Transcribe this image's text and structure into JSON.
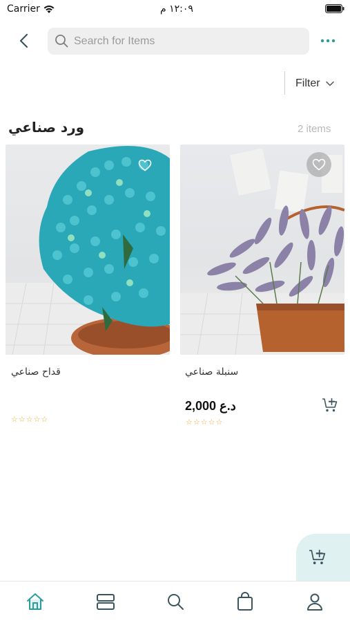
{
  "status_bar": {
    "carrier": "Carrier",
    "time": "١٢:٠٩ م"
  },
  "header": {
    "search_placeholder": "Search for Items",
    "icons": [
      "back-icon",
      "search-icon",
      "more-icon"
    ]
  },
  "filter": {
    "label": "Filter"
  },
  "section": {
    "title": "ورد صناعي",
    "count": "2 items"
  },
  "products": [
    {
      "name": "قداح صناعي",
      "price": "",
      "rating": "☆☆☆☆☆",
      "favorite_icon": "heart-outline-icon"
    },
    {
      "name": "سنبلة صناعي",
      "price": "2,000 د.ع",
      "rating": "☆☆☆☆☆",
      "favorite_icon": "heart-outline-icon"
    }
  ],
  "bottom_nav": {
    "items": [
      "home-icon",
      "categories-icon",
      "search-icon",
      "bag-icon",
      "profile-icon"
    ],
    "active": "home-icon"
  },
  "colors": {
    "accent": "#2a9d9a",
    "icon_dark": "#3b5560",
    "star": "#f0a830",
    "float_bg": "#dff1f0"
  }
}
